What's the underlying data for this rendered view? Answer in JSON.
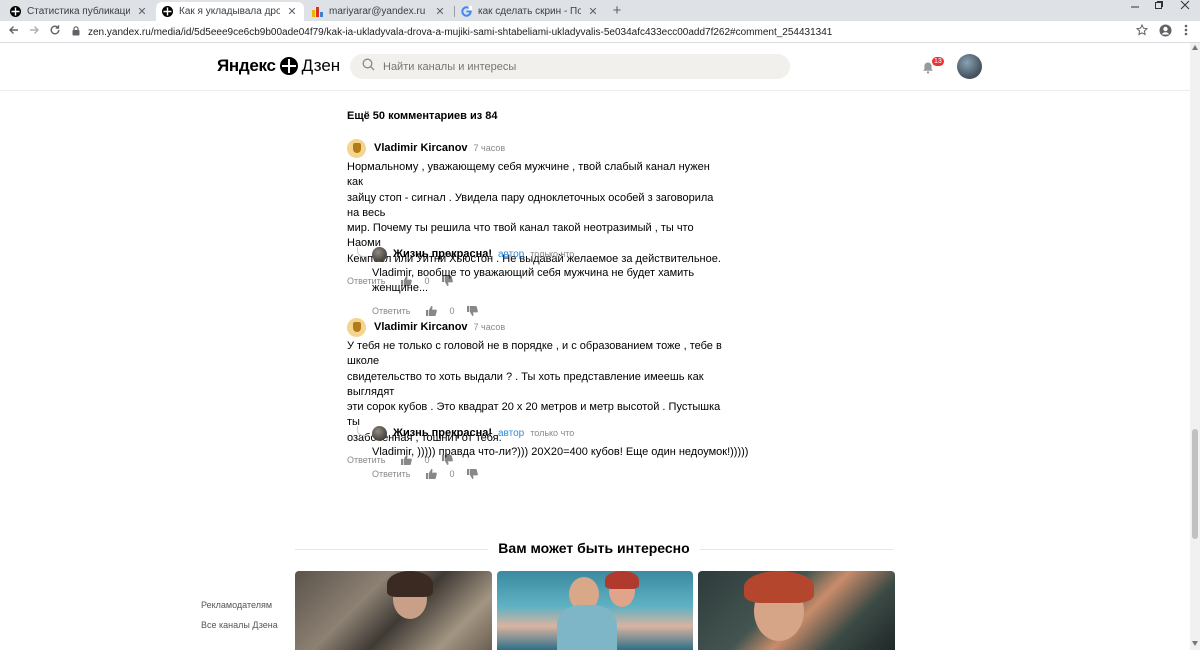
{
  "browser": {
    "tabs": [
      {
        "title": "Статистика публикаций | Яндекс",
        "favicon": "zen-icon",
        "active": false
      },
      {
        "title": "Как я укладывала дрова, а мужч",
        "favicon": "zen-icon",
        "active": true
      },
      {
        "title": "mariyarar@yandex.ru — сводка",
        "favicon": "mail-icon",
        "active": false
      },
      {
        "title": "как сделать скрин - Поиск в Goo",
        "favicon": "google-icon",
        "active": false
      }
    ],
    "close_glyph": "✕",
    "newtab_glyph": "+",
    "url": "zen.yandex.ru/media/id/5d5eee9ce6cb9b00ade04f79/kak-ia-ukladyvala-drova-a-mujiki-sami-shtabeliami-ukladyvalis-5e034afc433ecc00add7f262#comment_254431341"
  },
  "header": {
    "logo_part1": "Яндекс",
    "logo_part2": "Дзен",
    "search_placeholder": "Найти каналы и интересы",
    "notifications_count": "13"
  },
  "comments_section": {
    "more_label": "Ещё 50 комментариев из 84",
    "reply_label": "Ответить",
    "comments": [
      {
        "author": "Vladimir Kircanov",
        "time": "7 часов",
        "text": "Нормальному , уважающему себя мужчине , твой слабый канал нужен как\nзайцу стоп - сигнал . Увидела пару одноклеточных особей з заговорила на весь\nмир. Почему ты решила что твой канал такой неотразимый , ты что Наоми\nКемпбел или Уитни Хьюстон . Не выдавай желаемое за действительное.",
        "likes": "0",
        "reply": {
          "author": "Жизнь прекрасна!",
          "role": "автор",
          "time": "только что",
          "text": "Vladimir, вообще то уважающий себя мужчина не будет хамить женщине...",
          "likes": "0"
        }
      },
      {
        "author": "Vladimir Kircanov",
        "time": "7 часов",
        "text": "У тебя не только с головой не в порядке , и с образованием тоже , тебе в школе\nсвидетельство то хоть выдали ? . Ты хоть представление имеешь как выглядят\nэти сорок кубов . Это квадрат 20 х 20 метров и метр высотой . Пустышка ты\nозабоченная , тошнит от тебя.",
        "likes": "0",
        "reply": {
          "author": "Жизнь прекрасна!",
          "role": "автор",
          "time": "только что",
          "text": "Vladimir, ))))) правда что-ли?))) 20Х20=400 кубов! Еще один недоумок!)))))",
          "likes": "0"
        }
      }
    ]
  },
  "recommendations": {
    "title": "Вам может быть интересно"
  },
  "footer": {
    "links": [
      "Рекламодателям",
      "Все каналы Дзена"
    ]
  },
  "colors": {
    "accent_role": "#2f8bd9",
    "badge": "#e83434",
    "search_bg": "#f1f0ed"
  }
}
